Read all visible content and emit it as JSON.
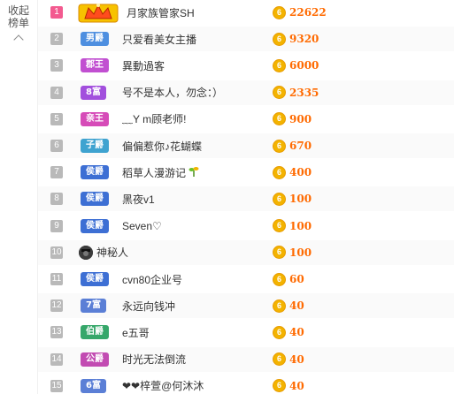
{
  "sidebar": {
    "collapse_label": "收起榜单"
  },
  "colors": {
    "accent_score": "#ff6a00",
    "coin": "#f3b300",
    "rank_top": "#f35a8f",
    "rank_default": "#b9b9b9"
  },
  "rows": [
    {
      "rank": "1",
      "badge": "",
      "badge_icon": "crown-badge-icon",
      "badge_color": "",
      "name": "月家族管家SH",
      "coin": "6",
      "score": "22622"
    },
    {
      "rank": "2",
      "badge": "男爵",
      "badge_color": "#4e8fe0",
      "name": "只爱看美女主播",
      "coin": "6",
      "score": "9320"
    },
    {
      "rank": "3",
      "badge": "郡王",
      "badge_color": "#c14fd1",
      "name": "異動過客",
      "coin": "6",
      "score": "6000"
    },
    {
      "rank": "4",
      "badge": "8富",
      "badge_color": "#a24fdd",
      "name": "号不是本人，勿念：）",
      "coin": "6",
      "score": "2335"
    },
    {
      "rank": "5",
      "badge": "亲王",
      "badge_color": "#d64bb8",
      "name": "﹏Y m顾老师!",
      "coin": "6",
      "score": "900"
    },
    {
      "rank": "6",
      "badge": "子爵",
      "badge_color": "#3fa3d0",
      "name": "偏偏惹你♪花蝴蝶",
      "coin": "6",
      "score": "670"
    },
    {
      "rank": "7",
      "badge": "侯爵",
      "badge_color": "#3d6fd4",
      "name": "稻草人漫游记",
      "coin": "6",
      "score": "400",
      "extra_icon": "sprout-icon"
    },
    {
      "rank": "8",
      "badge": "侯爵",
      "badge_color": "#3d6fd4",
      "name": "黑夜v1",
      "coin": "6",
      "score": "100"
    },
    {
      "rank": "9",
      "badge": "侯爵",
      "badge_color": "#3d6fd4",
      "name": "Seven♡",
      "coin": "6",
      "score": "100"
    },
    {
      "rank": "10",
      "badge": "",
      "badge_icon": "mystery-person-icon",
      "badge_color": "",
      "name": "神秘人",
      "coin": "6",
      "score": "100"
    },
    {
      "rank": "11",
      "badge": "侯爵",
      "badge_color": "#3d6fd4",
      "name": "cvn80企业号",
      "coin": "6",
      "score": "60"
    },
    {
      "rank": "12",
      "badge": "7富",
      "badge_color": "#5b7fd6",
      "name": "永远向钱冲",
      "coin": "6",
      "score": "40"
    },
    {
      "rank": "13",
      "badge": "伯爵",
      "badge_color": "#36a76a",
      "name": "e五哥",
      "coin": "6",
      "score": "40"
    },
    {
      "rank": "14",
      "badge": "公爵",
      "badge_color": "#c24bb2",
      "name": "时光无法倒流",
      "coin": "6",
      "score": "40"
    },
    {
      "rank": "15",
      "badge": "6富",
      "badge_color": "#5b7fd6",
      "name": "❤❤梓萱@何沐沐",
      "coin": "6",
      "score": "40"
    }
  ]
}
